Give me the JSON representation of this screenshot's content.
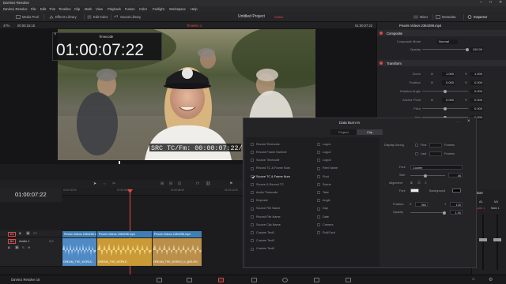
{
  "window": {
    "title": "DaVinci Resolve"
  },
  "menu": [
    "DaVinci Resolve",
    "File",
    "Edit",
    "Trim",
    "Timeline",
    "Clip",
    "Mark",
    "View",
    "Playback",
    "Fusion",
    "Color",
    "Fairlight",
    "Workspace",
    "Help"
  ],
  "toolbar": {
    "media_pool": "Media Pool",
    "effects_library": "Effects Library",
    "edit_index": "Edit Index",
    "sound_library": "Sound Library",
    "project_title": "Untitled Project",
    "project_status": "Edited",
    "mixer": "Mixer",
    "metadata": "Metadata",
    "inspector": "Inspector"
  },
  "viewer": {
    "zoom": "47%",
    "timecode_left": "00:00:15:16",
    "timeline_name": "Timeline 1",
    "timecode_right": "01:00:07:22",
    "overlay_title": "Timecode",
    "overlay_timecode": "01:00:07:22",
    "burnin_text": "SRC TC/Fm: 00:00:07:22/23"
  },
  "inspector": {
    "clip_name": "Pexels Videos 2364298.mp4",
    "composite_header": "Composite",
    "composite_mode_label": "Composite Mode",
    "composite_mode_value": "Normal",
    "opacity_label": "Opacity",
    "opacity_value": "100.00",
    "transform_header": "Transform",
    "rows": [
      {
        "label": "Zoom",
        "x_label": "X",
        "x": "1.000",
        "y_label": "Y",
        "y": "1.000"
      },
      {
        "label": "Position",
        "x_label": "X",
        "x": "0.000",
        "y_label": "Y",
        "y": "0.000"
      },
      {
        "label": "Rotation Angle",
        "x_label": "",
        "x": "",
        "y_label": "",
        "y": "0.000"
      },
      {
        "label": "Anchor Point",
        "x_label": "X",
        "x": "0.000",
        "y_label": "Y",
        "y": "0.000"
      },
      {
        "label": "Pitch",
        "x_label": "",
        "x": "",
        "y_label": "",
        "y": "0.000"
      },
      {
        "label": "Yaw",
        "x_label": "",
        "x": "",
        "y_label": "",
        "y": "0.000"
      }
    ]
  },
  "timeline": {
    "timecode": "01:00:07:22",
    "ruler_labels": [
      "01:00:00:00",
      "01:00:04:00",
      "01:00:08:00",
      "01:00:12:00",
      "01:00:16:00"
    ],
    "video_track_label": "V1",
    "audio_track_label": "A1",
    "audio_track_name": "Audio 1",
    "audio_track_level": "2.0",
    "video_clips": [
      "Pexels Videos 2364298.mp4",
      "Pexels Videos 2364298.mp4",
      "Pexels Videos 2364298.mp4"
    ],
    "audio_clips": [
      "DREAM_THE_WORLD",
      "DREAM_THE_WORLD",
      "DREAM_THE_WORLD_b_@ELVIN"
    ]
  },
  "mixer": {
    "title": "Mixer",
    "channels": [
      "A1",
      "M1"
    ],
    "channel_names": [
      "Audio 1",
      "Main 1"
    ]
  },
  "burnin_dialog": {
    "title": "Data Burn-In",
    "tab_project": "Project",
    "tab_clip": "Clip",
    "col1": [
      {
        "label": "Record Timecode",
        "checked": false
      },
      {
        "label": "Record Frame Number",
        "checked": false
      },
      {
        "label": "Source Timecode",
        "checked": false
      },
      {
        "label": "Record TC & Frame Num",
        "checked": false
      },
      {
        "label": "Source TC & Frame Num",
        "checked": true
      },
      {
        "label": "Source & Record TC",
        "checked": false
      },
      {
        "label": "Audio Timecode",
        "checked": false
      },
      {
        "label": "Keycode",
        "checked": false
      },
      {
        "label": "Source File Name",
        "checked": false
      },
      {
        "label": "Record File Name",
        "checked": false
      },
      {
        "label": "Source Clip Name",
        "checked": false
      },
      {
        "label": "Custom Text1",
        "checked": false
      },
      {
        "label": "Custom Text2",
        "checked": false
      },
      {
        "label": "Custom Text3",
        "checked": false
      }
    ],
    "col2": [
      {
        "label": "Logo1",
        "checked": false
      },
      {
        "label": "Logo2",
        "checked": false
      },
      {
        "label": "Logo3",
        "checked": false
      },
      {
        "label": "Reel Name",
        "checked": false
      },
      {
        "label": "Shot",
        "checked": false
      },
      {
        "label": "Scene",
        "checked": false
      },
      {
        "label": "Take",
        "checked": false
      },
      {
        "label": "Angle",
        "checked": false
      },
      {
        "label": "Day",
        "checked": false
      },
      {
        "label": "Date",
        "checked": false
      },
      {
        "label": "Camera",
        "checked": false
      },
      {
        "label": "Roll/Card",
        "checked": false
      }
    ],
    "display_during": "Display During",
    "first_label": "First",
    "last_label": "Last",
    "frames_label": "Frames",
    "font_label": "Font",
    "font_value": "Courier",
    "size_label": "Size",
    "size_value": "46",
    "alignment_label": "Alignment",
    "font_color_label": "Font",
    "background_label": "Background",
    "position_label": "Position",
    "pos_x_label": "X",
    "pos_x": "960",
    "pos_y_label": "Y",
    "pos_y": "130",
    "opacity_label": "Opacity",
    "opacity_value": "1.00"
  },
  "page_tabs": [
    "media-icon",
    "cut-icon",
    "edit-icon",
    "fusion-icon",
    "color-icon",
    "fairlight-icon",
    "deliver-icon"
  ],
  "app_footer": "DaVinci Resolve 16",
  "colors": {
    "accent_red": "#e0473f",
    "clip_blue": "#3f7fb4",
    "clip_audio": "#c99a36",
    "clip_audio_alt": "#4f8ac4"
  }
}
